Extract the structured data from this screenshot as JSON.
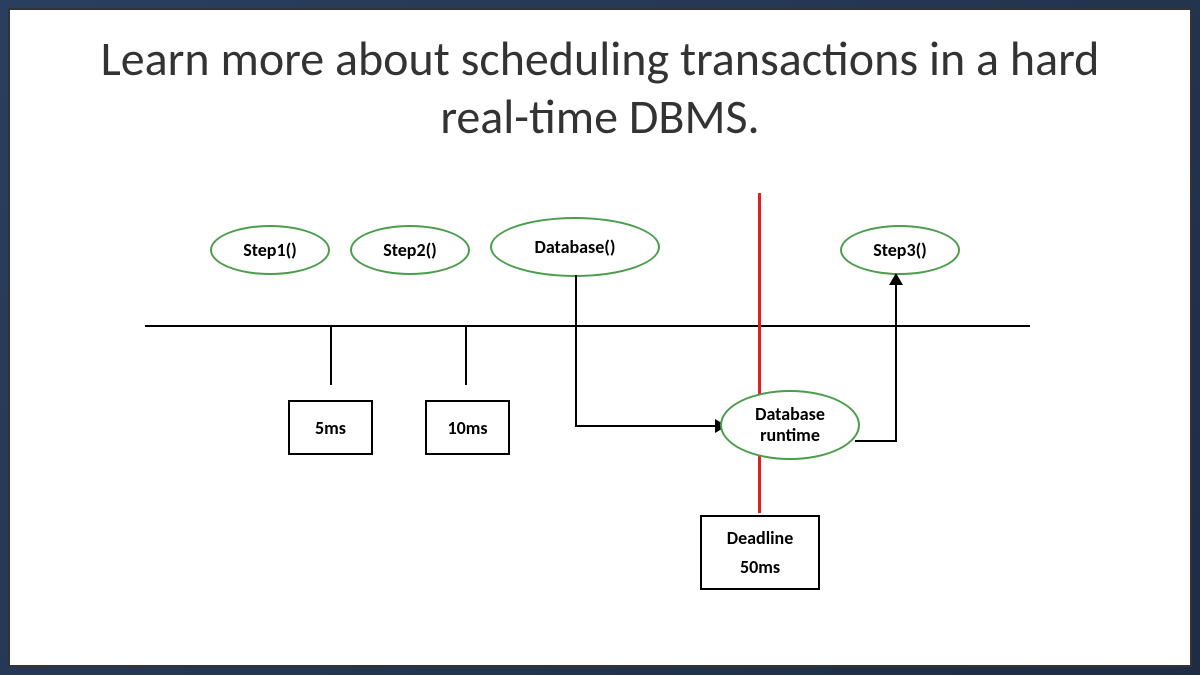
{
  "title": "Learn more about scheduling transactions in a hard real-time DBMS.",
  "diagram": {
    "nodes": {
      "step1": "Step1()",
      "step2": "Step2()",
      "database": "Database()",
      "step3": "Step3()",
      "runtime_line1": "Database",
      "runtime_line2": "runtime"
    },
    "durations": {
      "step1": "5ms",
      "step2": "10ms"
    },
    "deadline": {
      "label": "Deadline",
      "value": "50ms"
    }
  }
}
